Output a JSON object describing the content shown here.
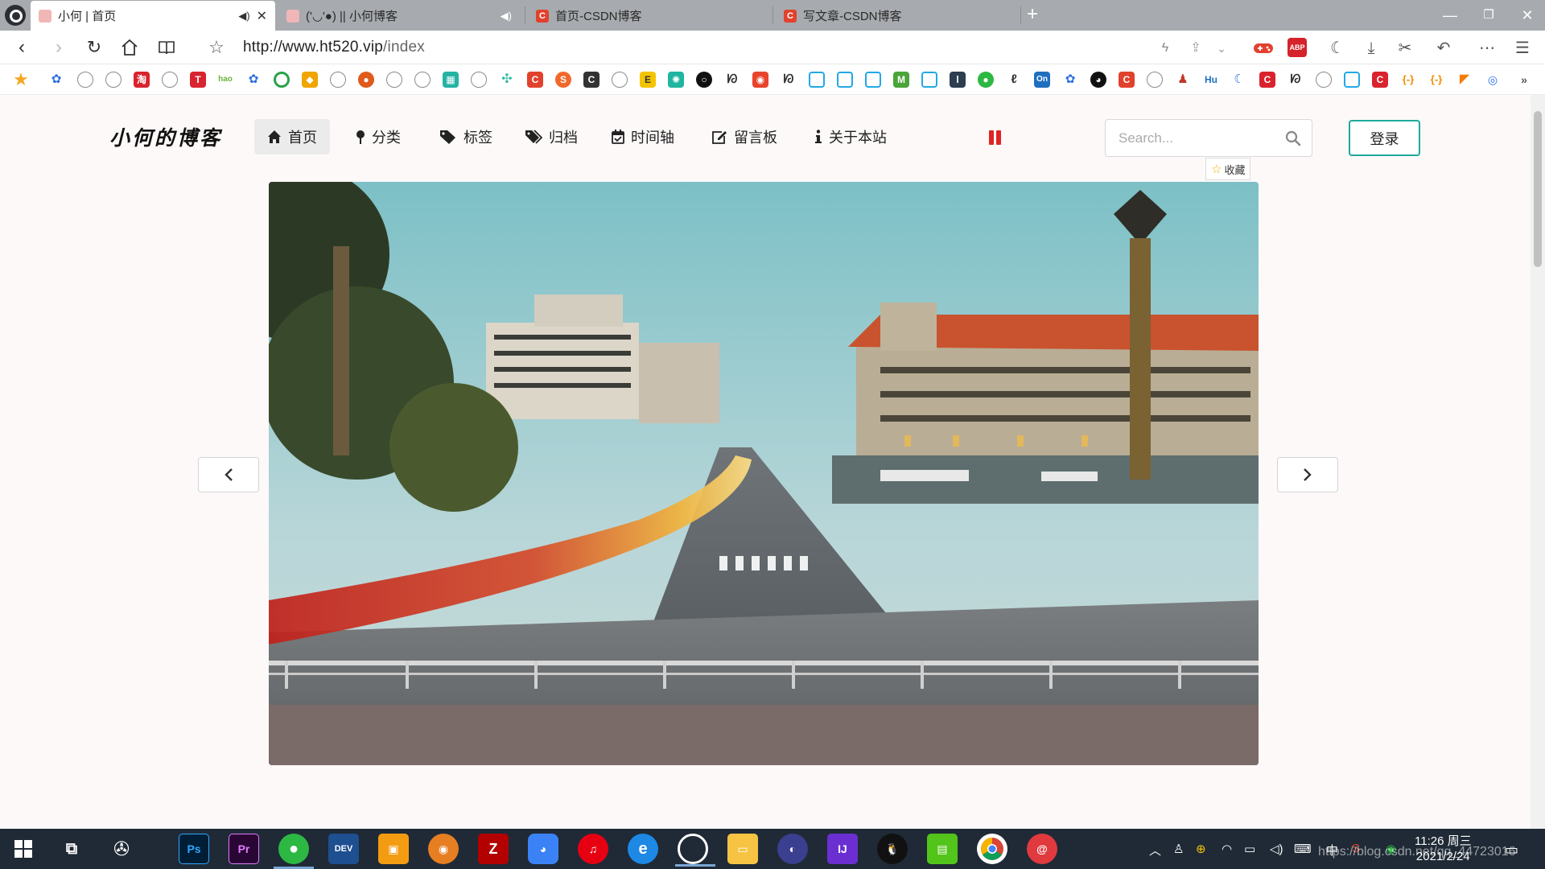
{
  "browser": {
    "tabs": [
      {
        "title": "小何 | 首页",
        "active": true
      },
      {
        "title": "('◡'●) || 小何博客",
        "active": false
      },
      {
        "title": "首页-CSDN博客",
        "active": false
      },
      {
        "title": "写文章-CSDN博客",
        "active": false
      }
    ],
    "address": {
      "host": "http://www.ht520.vip",
      "path": "/index"
    }
  },
  "site": {
    "logo": "小何的博客",
    "menu": [
      {
        "label": "首页",
        "icon": "home-icon"
      },
      {
        "label": "分类",
        "icon": "pin-icon"
      },
      {
        "label": "标签",
        "icon": "tag-icon"
      },
      {
        "label": "归档",
        "icon": "tags-icon"
      },
      {
        "label": "时间轴",
        "icon": "calendar-check-icon"
      },
      {
        "label": "留言板",
        "icon": "edit-icon"
      },
      {
        "label": "关于本站",
        "icon": "info-icon"
      }
    ],
    "search": {
      "placeholder": "Search..."
    },
    "login_label": "登录",
    "favorite_label": "收藏"
  },
  "taskbar": {
    "apps": [
      "Ps",
      "Pr",
      "DEV"
    ],
    "clock": {
      "time": "11:26 周三",
      "date": "2021/2/24"
    },
    "watermark": "https://blog.csdn.net/qq_44723016"
  },
  "colors": {
    "accent": "#1ea99c",
    "music": "#e02424",
    "csdn": "#e0422d"
  }
}
